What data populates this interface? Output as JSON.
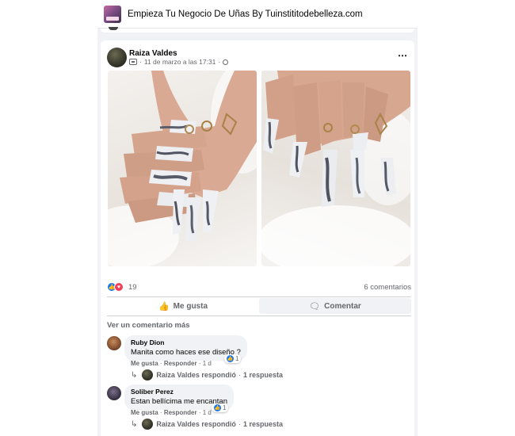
{
  "group": {
    "title": "Empieza Tu Negocio De Uñas By Tuinstititodebelleza.com",
    "thumb_icon": "group-cover-thumbnail"
  },
  "post": {
    "author": "Raiza Valdes",
    "timestamp": "11 de marzo a las 17:31",
    "separator": "·",
    "audience_icon": "globe-icon",
    "more_icon": "⋯",
    "photos": [
      {
        "subject": "marble nails photo 1"
      },
      {
        "subject": "marble nails photo 2"
      }
    ],
    "reaction_count": "19",
    "comment_count": "6 comentarios",
    "actions": {
      "like": "Me gusta",
      "comment": "Comentar"
    },
    "view_more_comments": "Ver un comentario más",
    "comments": [
      {
        "name": "Ruby Dion",
        "text": "Manita como haces ese diseño ?",
        "like": "Me gusta",
        "reply": "Responder",
        "time": "1 d",
        "reactions": "1",
        "reply_author": "Raiza Valdes respondió",
        "reply_count": "1 respuesta"
      },
      {
        "name": "Soliber Perez",
        "text": "Estan bellícima me encantan",
        "like": "Me gusta",
        "reply": "Responder",
        "time": "1 d",
        "reactions": "1",
        "reply_author": "Raiza Valdes respondió",
        "reply_count": "1 respuesta"
      }
    ]
  },
  "colors": {
    "accent": "#1877f2",
    "love": "#f33e58",
    "secondary_text": "#65676b",
    "feed_bg": "#f0f2f5"
  }
}
